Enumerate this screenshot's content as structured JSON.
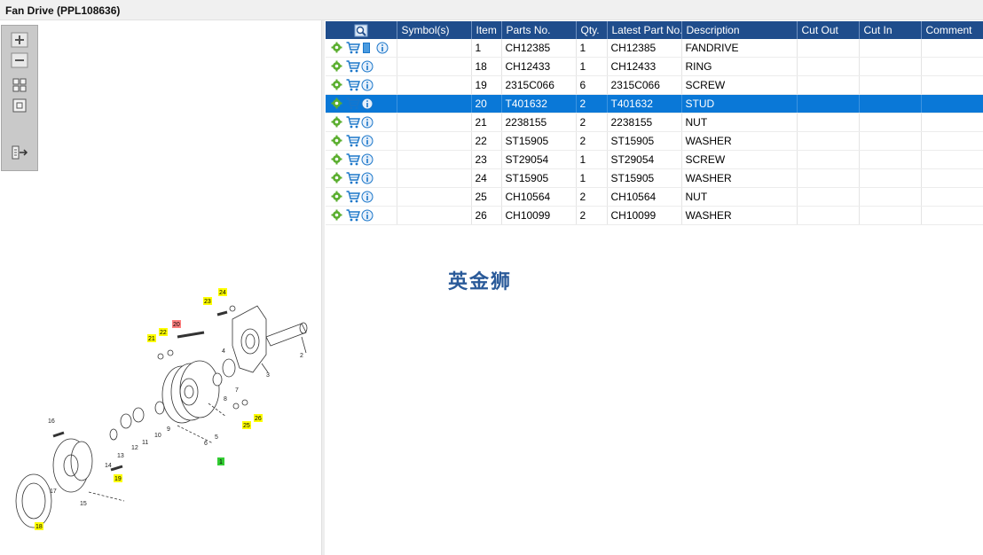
{
  "window": {
    "title": "Fan Drive (PPL108636)"
  },
  "toolbar": {
    "buttons": [
      {
        "name": "zoom-in-button",
        "icon": "plus-icon"
      },
      {
        "name": "zoom-out-button",
        "icon": "minus-icon"
      },
      {
        "name": "fit-all-button",
        "icon": "grid-icon"
      },
      {
        "name": "actual-size-button",
        "icon": "square-icon"
      },
      {
        "name": "export-button",
        "icon": "list-arrow-icon"
      }
    ]
  },
  "table": {
    "header_icon": "magnifier-icon",
    "columns": [
      "Symbol(s)",
      "Item",
      "Parts No.",
      "Qty.",
      "Latest Part No.",
      "Description",
      "Cut Out",
      "Cut In",
      "Comment"
    ],
    "selected_index": 3,
    "rows": [
      {
        "item": "1",
        "part_no": "CH12385",
        "qty": "1",
        "latest": "CH12385",
        "desc": "FANDRIVE",
        "has_book": true
      },
      {
        "item": "18",
        "part_no": "CH12433",
        "qty": "1",
        "latest": "CH12433",
        "desc": "RING"
      },
      {
        "item": "19",
        "part_no": "2315C066",
        "qty": "6",
        "latest": "2315C066",
        "desc": "SCREW"
      },
      {
        "item": "20",
        "part_no": "T401632",
        "qty": "2",
        "latest": "T401632",
        "desc": "STUD"
      },
      {
        "item": "21",
        "part_no": "2238155",
        "qty": "2",
        "latest": "2238155",
        "desc": "NUT"
      },
      {
        "item": "22",
        "part_no": "ST15905",
        "qty": "2",
        "latest": "ST15905",
        "desc": "WASHER"
      },
      {
        "item": "23",
        "part_no": "ST29054",
        "qty": "1",
        "latest": "ST29054",
        "desc": "SCREW"
      },
      {
        "item": "24",
        "part_no": "ST15905",
        "qty": "1",
        "latest": "ST15905",
        "desc": "WASHER"
      },
      {
        "item": "25",
        "part_no": "CH10564",
        "qty": "2",
        "latest": "CH10564",
        "desc": "NUT"
      },
      {
        "item": "26",
        "part_no": "CH10099",
        "qty": "2",
        "latest": "CH10099",
        "desc": "WASHER"
      }
    ]
  },
  "watermark": "英金狮",
  "diagram": {
    "callouts_yellow": [
      "24",
      "23",
      "22",
      "21",
      "26",
      "25",
      "19",
      "18"
    ],
    "callouts_red": [
      "20"
    ],
    "callouts_green": [
      "1"
    ],
    "labels": [
      "2",
      "3",
      "4",
      "5",
      "6",
      "7",
      "8",
      "9",
      "10",
      "11",
      "12",
      "13",
      "14",
      "15",
      "16",
      "17"
    ]
  },
  "colors": {
    "header": "#1f4d8c",
    "selected_row": "#0a78d7",
    "callout_yellow": "#ffff00",
    "callout_red": "#ff8080",
    "callout_green": "#33cc33",
    "watermark": "#2a5a99"
  }
}
